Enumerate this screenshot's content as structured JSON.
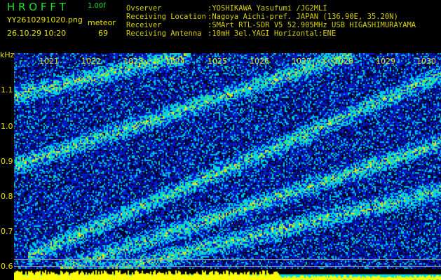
{
  "header": {
    "app_title": "H R O F F T",
    "version": "1.00f",
    "filename": "YY2610291020.png",
    "datetime": "26.10.29 10:20",
    "mode_label": "meteor",
    "meteor_count": "69"
  },
  "info": [
    {
      "label": "Ovserver",
      "value": ":YOSHIKAWA Yasufumi /JG2MLI"
    },
    {
      "label": "Receiving Location",
      "value": ":Nagoya Aichi-pref. JAPAN (136.90E, 35.20N)"
    },
    {
      "label": "Receiver",
      "value": ":SMArt RTL-SDR V5 52.905MHz USB HIGASHIMURAYAMA"
    },
    {
      "label": "Receiving Antenna",
      "value": ":10mH 3el.YAGI Horizontal:ENE"
    }
  ],
  "axis": {
    "y_unit": "kHz",
    "y_ticks": [
      "1.1",
      "1.0",
      "0.9",
      "0.8",
      "0.7",
      "0.6"
    ],
    "x_ticks": [
      "1021",
      "1022",
      "1023",
      "1024",
      "1025",
      "1026",
      "1027",
      "1028",
      "1029",
      "1030"
    ]
  },
  "colors": {
    "text": "#e8e000",
    "title": "#22e022",
    "bars": "#ffff00",
    "baseline": "#00e0e0"
  }
}
